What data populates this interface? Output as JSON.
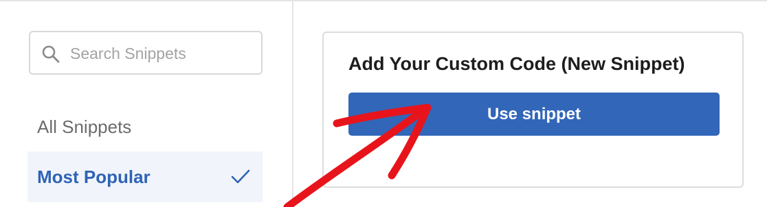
{
  "search": {
    "placeholder": "Search Snippets",
    "value": ""
  },
  "sidebar": {
    "items": [
      {
        "label": "All Snippets",
        "selected": false
      },
      {
        "label": "Most Popular",
        "selected": true
      }
    ]
  },
  "card": {
    "title": "Add Your Custom Code (New Snippet)",
    "button_label": "Use snippet"
  },
  "colors": {
    "accent": "#3266b8",
    "selected_bg": "#f1f5fb",
    "annotation_arrow": "#e8141b"
  },
  "icons": [
    "search-icon",
    "checkmark-icon"
  ]
}
